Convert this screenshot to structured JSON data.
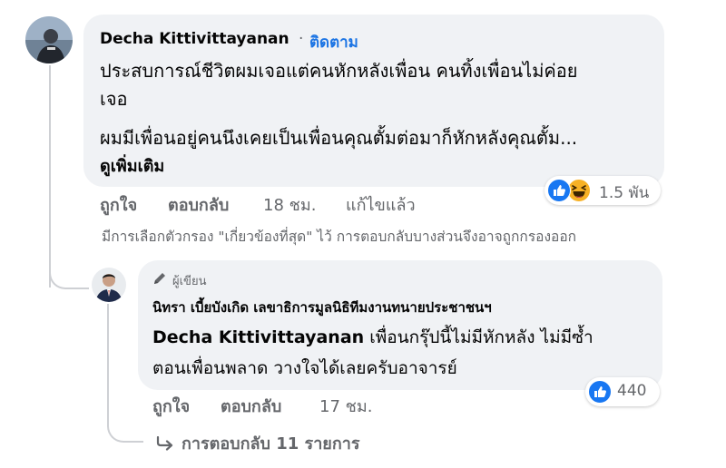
{
  "comment1": {
    "author": "Decha Kittivittayanan",
    "separator": "·",
    "follow_label": "ติดตาม",
    "text_line1": "ประสบการณ์ชีวิตผมเจอแต่คนหักหลังเพื่อน คนทิ้งเพื่อนไม่ค่อย",
    "text_line2": "เจอ",
    "text_line3": "ผมมีเพื่อนอยู่คนนึงเคยเป็นเพื่อนคุณตั้มต่อมาก็หักหลังคุณตั้ม...",
    "see_more": "ดูเพิ่มเติม",
    "like_label": "ถูกใจ",
    "reply_label": "ตอบกลับ",
    "time": "18 ชม.",
    "edited_label": "แก้ไขแล้ว",
    "reaction_count": "1.5 พัน",
    "reaction_icons": [
      "like-icon",
      "haha-icon"
    ]
  },
  "filter_note": "มีการเลือกตัวกรอง \"เกี่ยวข้องที่สุด\" ไว้ การตอบกลับบางส่วนจึงอาจถูกกรองออก",
  "reply1": {
    "author_badge": "ผู้เขียน",
    "author": "นิทรา เบี้ยบังเกิด เลขาธิการมูลนิธิทีมงานทนายประชาชนฯ",
    "mention": "Decha Kittivittayanan",
    "text_line1": " เพื่อนกรุ๊ปนี้ไม่มีหักหลัง ไม่มีซ้ำ",
    "text_line2": "ตอนเพื่อนพลาด วางใจได้เลยครับอาจารย์",
    "like_label": "ถูกใจ",
    "reply_label": "ตอบกลับ",
    "time": "17 ชม.",
    "reaction_count": "440",
    "reaction_icons": [
      "like-icon"
    ]
  },
  "more_replies": "การตอบกลับ 11 รายการ",
  "colors": {
    "accent": "#1b74e4",
    "bubble": "#f0f2f5",
    "secondary_text": "#65676b",
    "like_blue": "#1877f2",
    "haha_yellow": "#f7b125"
  }
}
